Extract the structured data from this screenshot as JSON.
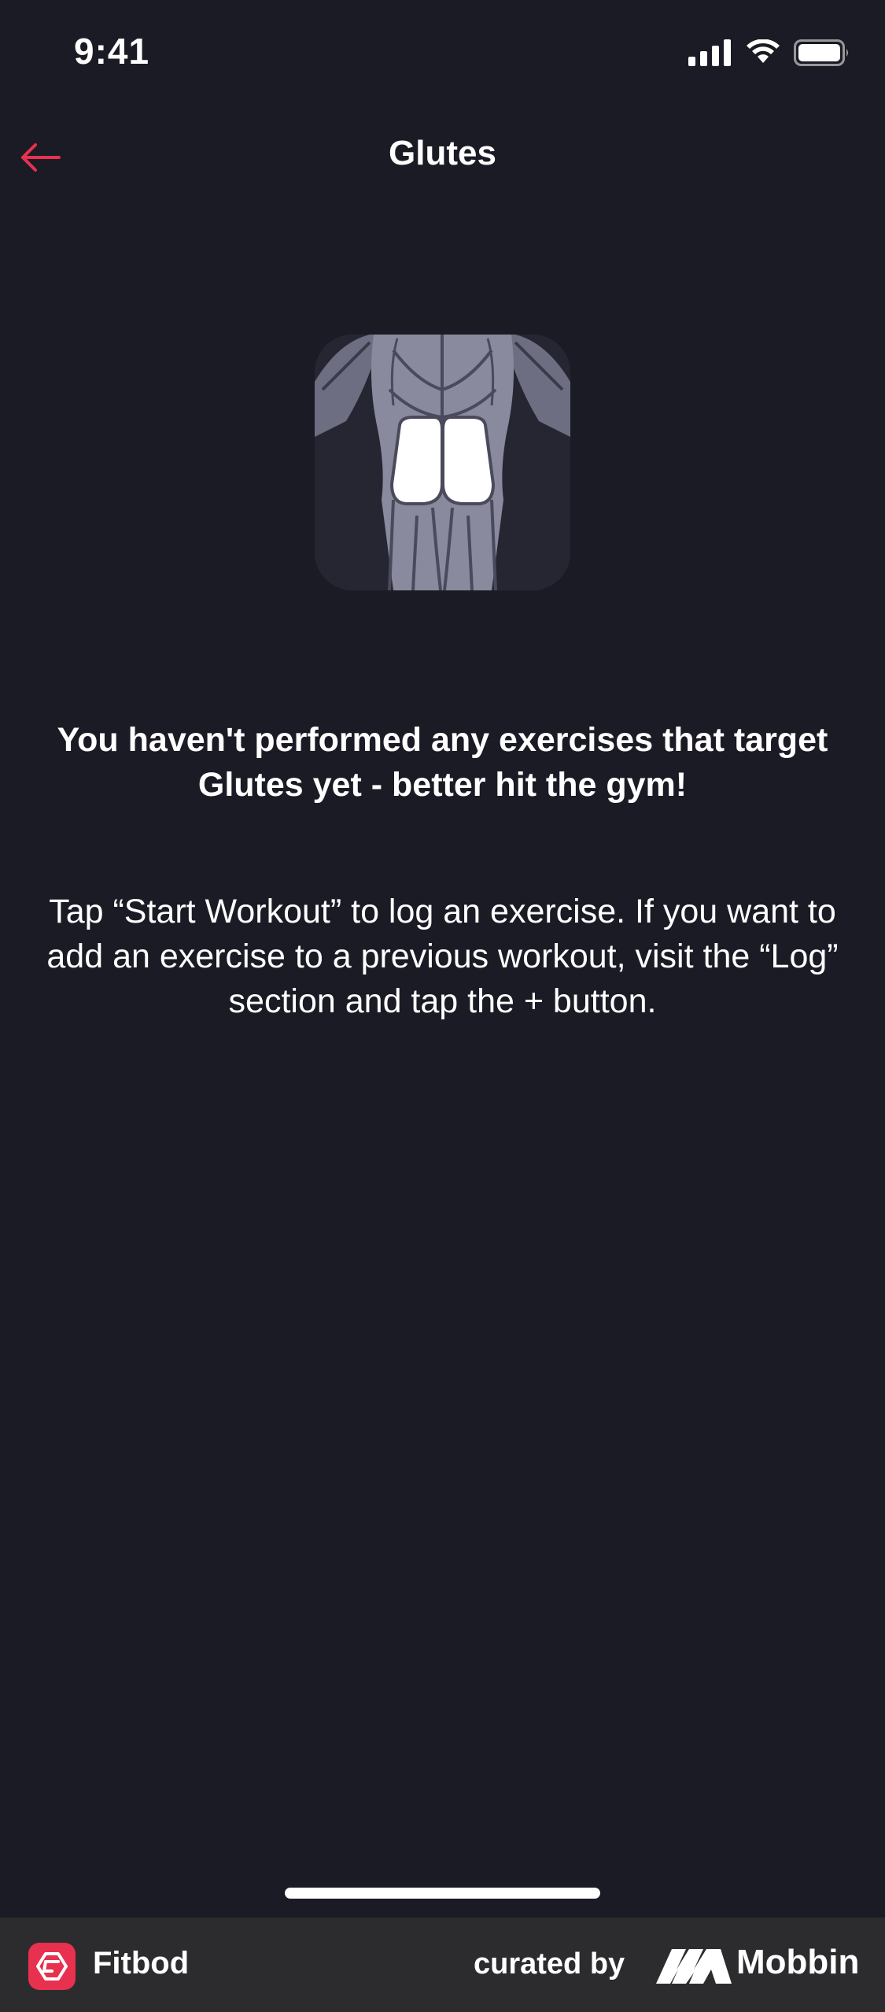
{
  "status_bar": {
    "time": "9:41",
    "signal_icon": "signal-icon",
    "wifi_icon": "wifi-icon",
    "battery_icon": "battery-icon"
  },
  "nav": {
    "back_icon": "arrow-left-icon",
    "title": "Glutes"
  },
  "muscle_image": {
    "icon": "glutes-muscle-illustration"
  },
  "empty_state": {
    "headline": "You haven't performed any exercises that target Glutes yet - better hit the gym!",
    "body": "Tap “Start Workout” to log an exercise. If you want to add an exercise to a previous workout, visit the “Log” section and tap the + button."
  },
  "footer": {
    "app_name": "Fitbod",
    "curated_by": "curated by",
    "brand": "Mobbin"
  },
  "colors": {
    "background": "#1b1b25",
    "accent": "#e8304f",
    "footer_background": "#2c2c2e"
  }
}
